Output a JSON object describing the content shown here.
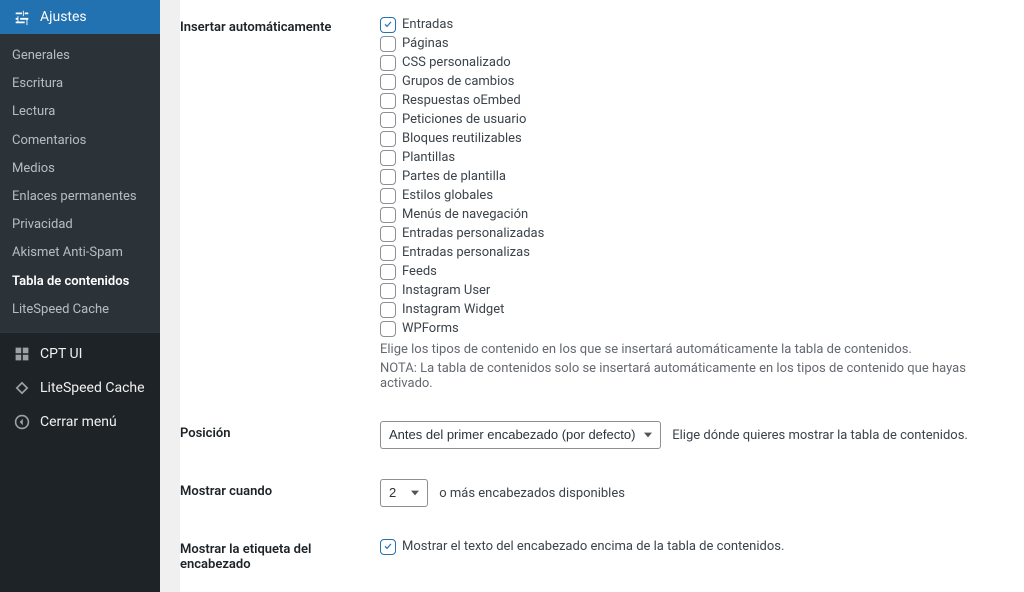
{
  "sidebar": {
    "ajustes": "Ajustes",
    "sub": {
      "generales": "Generales",
      "escritura": "Escritura",
      "lectura": "Lectura",
      "comentarios": "Comentarios",
      "medios": "Medios",
      "enlaces": "Enlaces permanentes",
      "privacidad": "Privacidad",
      "akismet": "Akismet Anti-Spam",
      "toc": "Tabla de contenidos",
      "litespeed": "LiteSpeed Cache"
    },
    "cptui": "CPT UI",
    "litespeed_root": "LiteSpeed Cache",
    "cerrar": "Cerrar menú"
  },
  "auto_insert": {
    "label": "Insertar automáticamente",
    "items": [
      {
        "label": "Entradas",
        "checked": true
      },
      {
        "label": "Páginas",
        "checked": false
      },
      {
        "label": "CSS personalizado",
        "checked": false
      },
      {
        "label": "Grupos de cambios",
        "checked": false
      },
      {
        "label": "Respuestas oEmbed",
        "checked": false
      },
      {
        "label": "Peticiones de usuario",
        "checked": false
      },
      {
        "label": "Bloques reutilizables",
        "checked": false
      },
      {
        "label": "Plantillas",
        "checked": false
      },
      {
        "label": "Partes de plantilla",
        "checked": false
      },
      {
        "label": "Estilos globales",
        "checked": false
      },
      {
        "label": "Menús de navegación",
        "checked": false
      },
      {
        "label": "Entradas personalizadas",
        "checked": false
      },
      {
        "label": "Entradas personalizas",
        "checked": false
      },
      {
        "label": "Feeds",
        "checked": false
      },
      {
        "label": "Instagram User",
        "checked": false
      },
      {
        "label": "Instagram Widget",
        "checked": false
      },
      {
        "label": "WPForms",
        "checked": false
      }
    ],
    "desc1": "Elige los tipos de contenido en los que se insertará automáticamente la tabla de contenidos.",
    "desc2": "NOTA: La tabla de contenidos solo se insertará automáticamente en los tipos de contenido que hayas activado."
  },
  "posicion": {
    "label": "Posición",
    "selected": "Antes del primer encabezado (por defecto)",
    "desc": "Elige dónde quieres mostrar la tabla de contenidos."
  },
  "mostrar_cuando": {
    "label": "Mostrar cuando",
    "selected": "2",
    "desc": "o más encabezados disponibles"
  },
  "mostrar_etiqueta": {
    "label": "Mostrar la etiqueta del encabezado",
    "option": "Mostrar el texto del encabezado encima de la tabla de contenidos.",
    "checked": true
  }
}
